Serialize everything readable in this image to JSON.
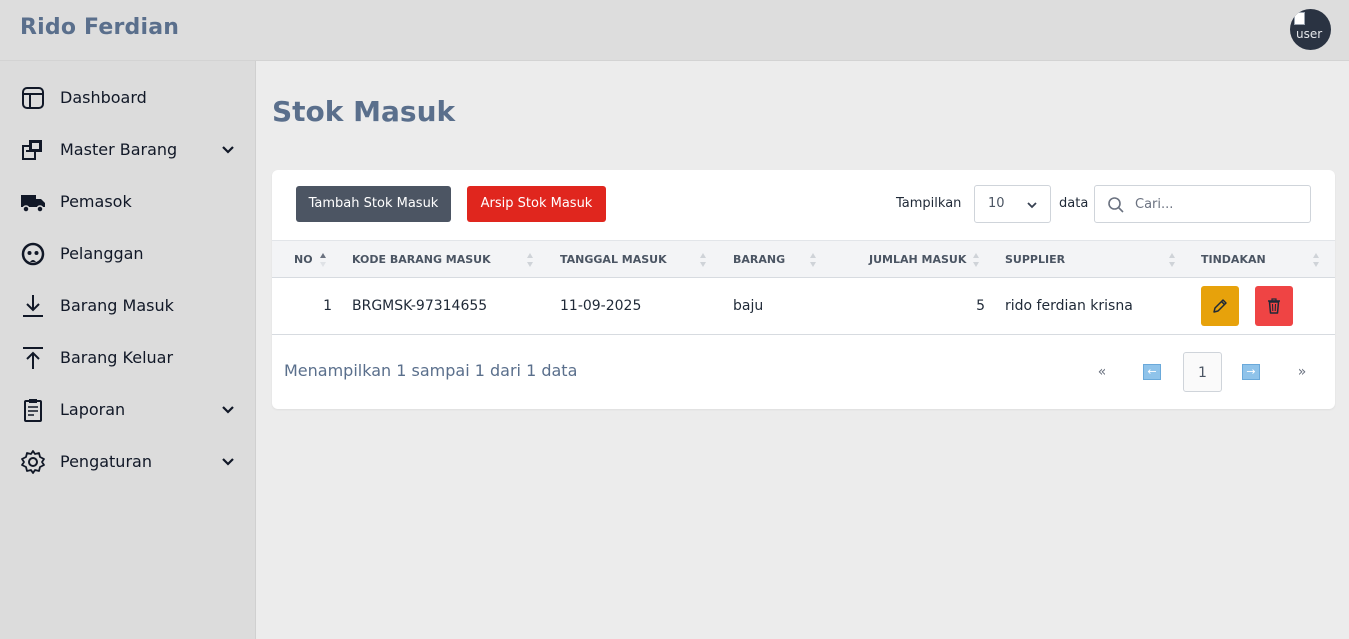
{
  "header": {
    "brand": "Rido Ferdian",
    "avatar_alt": "user"
  },
  "sidebar": {
    "items": [
      {
        "label": "Dashboard",
        "icon": "dashboard-icon"
      },
      {
        "label": "Master Barang",
        "icon": "boxes-icon",
        "has_submenu": true
      },
      {
        "label": "Pemasok",
        "icon": "truck-icon"
      },
      {
        "label": "Pelanggan",
        "icon": "customer-icon"
      },
      {
        "label": "Barang Masuk",
        "icon": "arrow-down-icon"
      },
      {
        "label": "Barang Keluar",
        "icon": "arrow-up-icon"
      },
      {
        "label": "Laporan",
        "icon": "report-icon",
        "has_submenu": true
      },
      {
        "label": "Pengaturan",
        "icon": "gear-icon",
        "has_submenu": true
      }
    ]
  },
  "page": {
    "title": "Stok Masuk"
  },
  "toolbar": {
    "add_label": "Tambah Stok Masuk",
    "archive_label": "Arsip Stok Masuk",
    "show_label": "Tampilkan",
    "page_size": "10",
    "data_label": "data",
    "search_placeholder": "Cari..."
  },
  "table": {
    "columns": [
      "NO",
      "KODE BARANG MASUK",
      "TANGGAL MASUK",
      "BARANG",
      "JUMLAH MASUK",
      "SUPPLIER",
      "TINDAKAN"
    ],
    "rows": [
      {
        "no": "1",
        "kode": "BRGMSK-97314655",
        "tanggal": "11-09-2025",
        "barang": "baju",
        "jumlah": "5",
        "supplier": "rido ferdian krisna"
      }
    ]
  },
  "footer": {
    "info": "Menampilkan 1 sampai 1 dari 1 data"
  },
  "pagination": {
    "first": "«",
    "prev": "←",
    "current": "1",
    "next": "→",
    "last": "»"
  },
  "colors": {
    "brand": "#5a6f8c",
    "add_button": "#4c5563",
    "archive_button": "#e0261e",
    "edit_button": "#e7a20b",
    "delete_button": "#ef4444"
  }
}
